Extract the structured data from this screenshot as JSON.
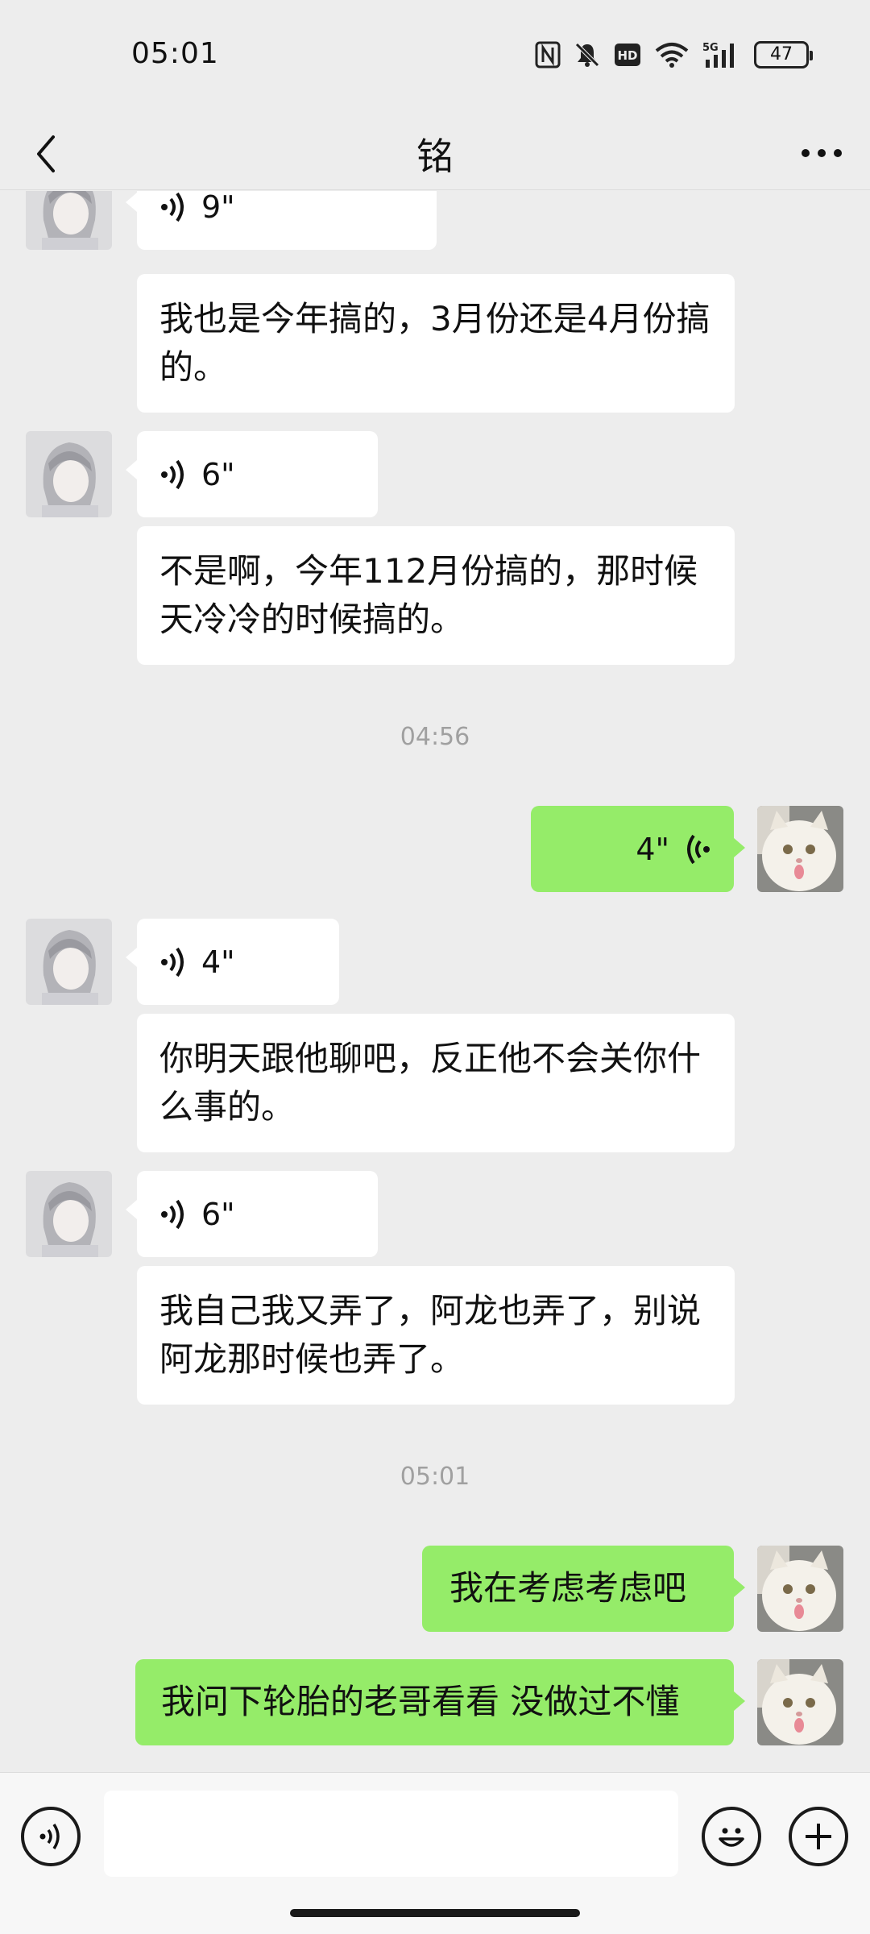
{
  "status_bar": {
    "time": "05:01",
    "battery": "47",
    "icons": [
      "nfc-icon",
      "mute-icon",
      "hd-icon",
      "wifi-icon",
      "signal-5g-icon",
      "battery-icon"
    ]
  },
  "header": {
    "title": "铭",
    "back_icon": "chevron-left-icon",
    "more_icon": "more-icon"
  },
  "messages": [
    {
      "type": "voice",
      "direction": "in",
      "duration": "9\""
    },
    {
      "type": "text",
      "direction": "in",
      "text": "我也是今年搞的，3月份还是4月份搞的。"
    },
    {
      "type": "voice",
      "direction": "in",
      "duration": "6\""
    },
    {
      "type": "text",
      "direction": "in",
      "text": "不是啊，今年112月份搞的，那时候天冷冷的时候搞的。"
    },
    {
      "type": "time",
      "text": "04:56"
    },
    {
      "type": "voice",
      "direction": "out",
      "duration": "4\""
    },
    {
      "type": "voice",
      "direction": "in",
      "duration": "4\""
    },
    {
      "type": "text",
      "direction": "in",
      "text": "你明天跟他聊吧，反正他不会关你什么事的。"
    },
    {
      "type": "voice",
      "direction": "in",
      "duration": "6\""
    },
    {
      "type": "text",
      "direction": "in",
      "text": "我自己我又弄了，阿龙也弄了，别说阿龙那时候也弄了。"
    },
    {
      "type": "time",
      "text": "05:01"
    },
    {
      "type": "text",
      "direction": "out",
      "text": "我在考虑考虑吧"
    },
    {
      "type": "text",
      "direction": "out",
      "text": "我问下轮胎的老哥看看 没做过不懂"
    }
  ],
  "input_bar": {
    "placeholder": "",
    "voice_icon": "voice-input-icon",
    "emoji_icon": "emoji-icon",
    "plus_icon": "plus-icon"
  },
  "colors": {
    "background": "#ededed",
    "incoming_bubble": "#ffffff",
    "outgoing_bubble": "#95ec69",
    "timestamp": "#a0a0a0"
  }
}
